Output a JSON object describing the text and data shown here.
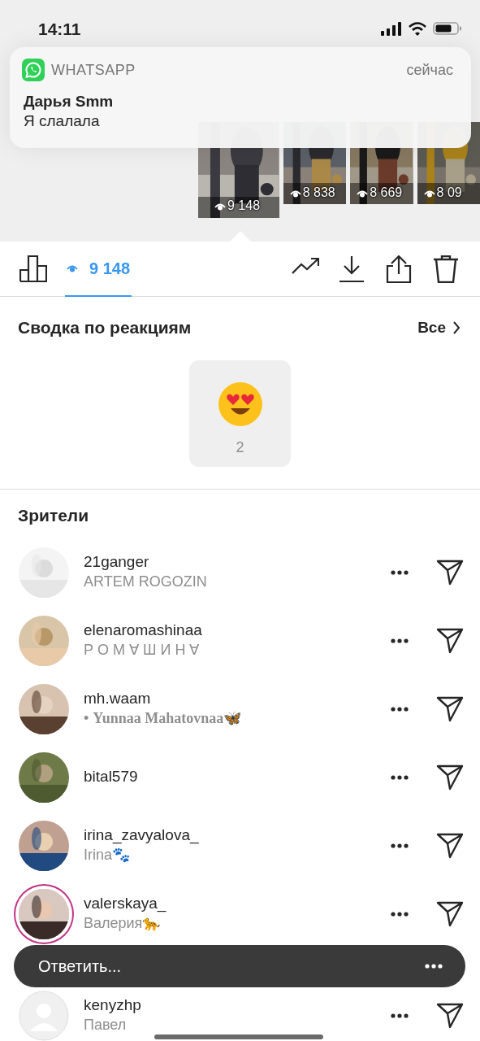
{
  "status_bar": {
    "time": "14:11"
  },
  "notification": {
    "app": "WHATSAPP",
    "time": "сейчас",
    "title": "Дарья Smm",
    "message": "Я слалала"
  },
  "stories": [
    {
      "views": "9 148",
      "selected": true
    },
    {
      "views": "8 838",
      "selected": false
    },
    {
      "views": "8 669",
      "selected": false
    },
    {
      "views": "8 09",
      "selected": false
    }
  ],
  "toolbar": {
    "tabs": [
      {
        "kind": "insights",
        "selected": false
      },
      {
        "kind": "viewers",
        "label": "9 148",
        "selected": true
      }
    ]
  },
  "reactions": {
    "title": "Сводка по реакциям",
    "all_link": "Все",
    "items": [
      {
        "count": "2"
      }
    ]
  },
  "viewers": {
    "title": "Зрители",
    "items": [
      {
        "username": "21ganger",
        "full_name": "ARTEM ROGOZIN",
        "kind": "picture",
        "story_ring": false
      },
      {
        "username": "elenaromashinaa",
        "full_name": "Р О М ∀ Ш И Н ∀",
        "kind": "picture",
        "story_ring": false
      },
      {
        "username": "mh.waam",
        "full_name": "• **Yunnaa Mahatovnaa**🦋",
        "kind": "picture",
        "story_ring": false
      },
      {
        "username": "bital579",
        "kind": "picture",
        "story_ring": false
      },
      {
        "username": "irina_zavyalova_",
        "full_name": "Irina🐾",
        "kind": "picture",
        "story_ring": false
      },
      {
        "username": "valerskaya_",
        "full_name": "Валерия🐆",
        "kind": "picture",
        "story_ring": true
      },
      {
        "username": "kenyzhp",
        "full_name": "Павел",
        "kind": "placeholder",
        "story_ring": false
      }
    ]
  },
  "reply_bar": {
    "placeholder": "Ответить..."
  }
}
